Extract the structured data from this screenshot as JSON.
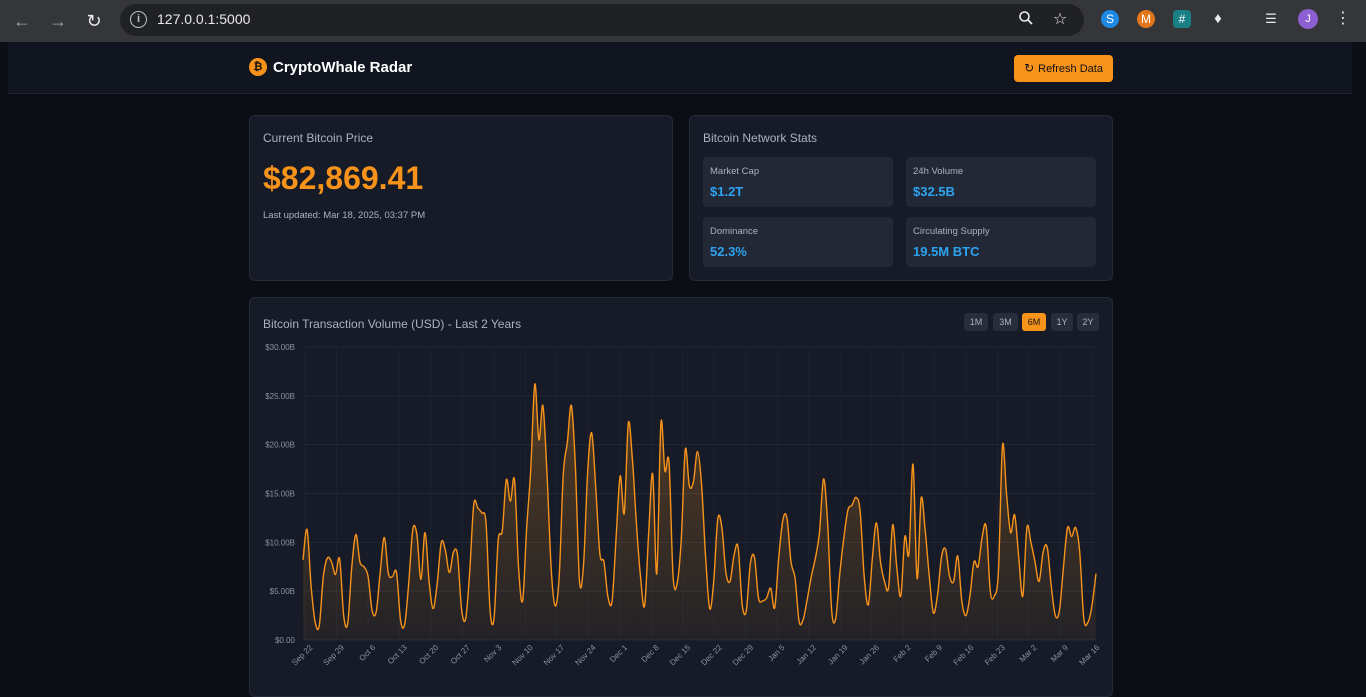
{
  "browser": {
    "url": "127.0.0.1:5000",
    "avatar_letter": "J"
  },
  "header": {
    "logo_symbol": "₿",
    "title": "CryptoWhale Radar",
    "refresh_label": "Refresh Data"
  },
  "price_card": {
    "title": "Current Bitcoin Price",
    "price": "$82,869.41",
    "updated": "Last updated: Mar 18, 2025, 03:37 PM"
  },
  "stats_card": {
    "title": "Bitcoin Network Stats",
    "stats": [
      {
        "label": "Market Cap",
        "value": "$1.2T"
      },
      {
        "label": "24h Volume",
        "value": "$32.5B"
      },
      {
        "label": "Dominance",
        "value": "52.3%"
      },
      {
        "label": "Circulating Supply",
        "value": "19.5M BTC"
      }
    ]
  },
  "chart_card": {
    "title": "Bitcoin Transaction Volume (USD) - Last 2 Years",
    "ranges": [
      "1M",
      "3M",
      "6M",
      "1Y",
      "2Y"
    ],
    "active_range": "6M"
  },
  "colors": {
    "accent": "#f7931a",
    "stat_value": "#2da3f0",
    "background": "#0b0e14",
    "card": "#161b27"
  },
  "chart_data": {
    "type": "area",
    "title": "Bitcoin Transaction Volume (USD) - Last 2 Years",
    "xlabel": "",
    "ylabel": "",
    "ylim": [
      0,
      30
    ],
    "y_unit": "B",
    "y_ticks": [
      "$0.00",
      "$5.00B",
      "$10.00B",
      "$15.00B",
      "$20.00B",
      "$25.00B",
      "$30.00B"
    ],
    "x_ticks": [
      "Sep 22",
      "Sep 29",
      "Oct 6",
      "Oct 13",
      "Oct 20",
      "Oct 27",
      "Nov 3",
      "Nov 10",
      "Nov 17",
      "Nov 24",
      "Dec 1",
      "Dec 8",
      "Dec 15",
      "Dec 22",
      "Dec 29",
      "Jan 5",
      "Jan 12",
      "Jan 19",
      "Jan 26",
      "Feb 2",
      "Feb 9",
      "Feb 16",
      "Feb 23",
      "Mar 2",
      "Mar 9",
      "Mar 16"
    ],
    "grid": true,
    "series": [
      {
        "values": [
          8.2,
          11.3,
          5.5,
          1.8,
          1.5,
          6.5,
          8.4,
          8.0,
          6.7,
          8.3,
          2.5,
          1.7,
          7.5,
          10.8,
          8.0,
          7.5,
          6.5,
          3.0,
          2.9,
          7.0,
          10.5,
          6.8,
          6.5,
          6.9,
          2.0,
          1.6,
          5.8,
          11.3,
          10.8,
          6.2,
          11.0,
          6.0,
          3.2,
          5.8,
          10.0,
          9.2,
          6.9,
          9.0,
          8.7,
          3.1,
          2.2,
          7.0,
          13.9,
          13.5,
          13.0,
          12.0,
          3.0,
          2.3,
          10.2,
          11.2,
          16.4,
          14.2,
          16.4,
          7.5,
          4.0,
          11.5,
          17.4,
          26.2,
          20.5,
          24.0,
          17.0,
          7.5,
          3.5,
          6.5,
          17.0,
          20.2,
          24.0,
          17.5,
          6.0,
          7.8,
          17.3,
          21.2,
          15.5,
          8.8,
          8.0,
          4.4,
          4.0,
          10.5,
          16.8,
          13.0,
          22.2,
          18.5,
          11.8,
          6.5,
          3.5,
          11.0,
          17.0,
          6.8,
          22.2,
          17.3,
          18.2,
          6.5,
          5.8,
          10.2,
          19.5,
          15.8,
          16.2,
          19.3,
          16.0,
          8.5,
          3.2,
          6.0,
          12.4,
          11.5,
          6.9,
          6.0,
          8.7,
          9.5,
          3.6,
          3.0,
          7.8,
          8.5,
          4.3,
          4.0,
          4.3,
          5.3,
          3.3,
          8.5,
          12.3,
          12.5,
          8.0,
          6.3,
          1.9,
          2.1,
          4.2,
          6.5,
          8.4,
          11.0,
          16.5,
          12.0,
          3.0,
          2.2,
          6.8,
          10.5,
          13.3,
          13.8,
          14.6,
          13.2,
          6.5,
          3.6,
          8.3,
          12.0,
          8.0,
          6.0,
          5.4,
          11.8,
          7.5,
          4.5,
          10.6,
          8.8,
          18.0,
          6.3,
          14.5,
          11.2,
          6.5,
          2.8,
          4.5,
          8.5,
          9.3,
          6.5,
          6.0,
          8.6,
          4.0,
          2.5,
          4.5,
          8.0,
          7.5,
          10.5,
          11.6,
          5.0,
          4.5,
          7.0,
          19.9,
          15.0,
          11.0,
          12.8,
          8.5,
          4.5,
          11.5,
          10.0,
          8.0,
          6.0,
          9.0,
          9.5,
          5.5,
          2.5,
          3.0,
          7.5,
          11.5,
          10.6,
          11.5,
          9.0,
          2.2,
          1.8,
          3.5,
          6.8
        ]
      }
    ]
  }
}
